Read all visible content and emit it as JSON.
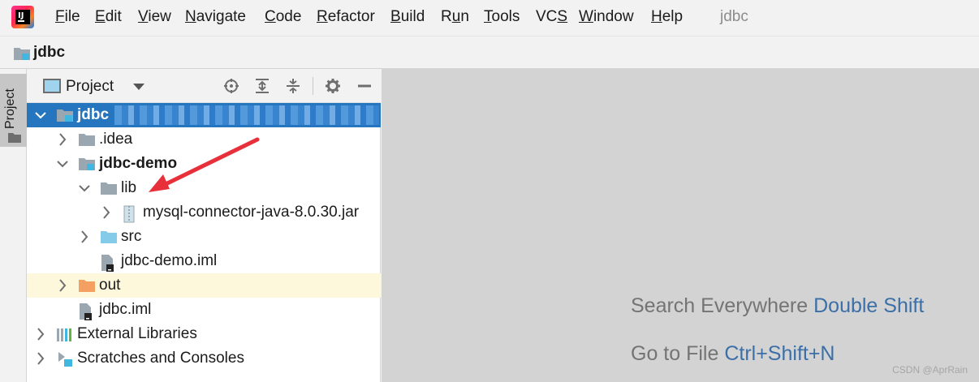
{
  "menu": {
    "items": [
      "File",
      "Edit",
      "View",
      "Navigate",
      "Code",
      "Refactor",
      "Build",
      "Run",
      "Tools",
      "VCS",
      "Window",
      "Help"
    ],
    "mnemonics": [
      "F",
      "E",
      "V",
      "N",
      "C",
      "R",
      "B",
      "u",
      "T",
      "S",
      "W",
      "H"
    ],
    "window_title": "jdbc"
  },
  "navbar": {
    "project_name": "jdbc"
  },
  "left_strip": {
    "project_tab": "Project"
  },
  "panel": {
    "title": "Project",
    "icons": [
      "locate-icon",
      "expand-all-icon",
      "collapse-all-icon",
      "gear-icon",
      "hide-icon"
    ]
  },
  "tree": [
    {
      "label": "jdbc",
      "indent": 0,
      "expanded": true,
      "icon": "module-folder-icon",
      "bold": true,
      "selected": true
    },
    {
      "label": ".idea",
      "indent": 1,
      "expanded": false,
      "icon": "folder-icon"
    },
    {
      "label": "jdbc-demo",
      "indent": 1,
      "expanded": true,
      "icon": "module-folder-icon",
      "bold": true
    },
    {
      "label": "lib",
      "indent": 2,
      "expanded": true,
      "icon": "folder-icon"
    },
    {
      "label": "mysql-connector-java-8.0.30.jar",
      "indent": 3,
      "expanded": false,
      "icon": "jar-icon"
    },
    {
      "label": "src",
      "indent": 2,
      "expanded": false,
      "icon": "source-folder-icon"
    },
    {
      "label": "jdbc-demo.iml",
      "indent": 2,
      "icon": "iml-file-icon"
    },
    {
      "label": "out",
      "indent": 1,
      "expanded": false,
      "icon": "excluded-folder-icon",
      "highlight": true
    },
    {
      "label": "jdbc.iml",
      "indent": 1,
      "icon": "iml-file-icon"
    },
    {
      "label": "External Libraries",
      "indent": 0,
      "expanded": false,
      "icon": "libraries-icon"
    },
    {
      "label": "Scratches and Consoles",
      "indent": 0,
      "expanded": false,
      "icon": "scratches-icon"
    }
  ],
  "editor": {
    "hints": [
      {
        "text": "Search Everywhere",
        "key": "Double Shift"
      },
      {
        "text": "Go to File",
        "key": "Ctrl+Shift+N"
      }
    ]
  },
  "watermark": "CSDN @AprRain",
  "colors": {
    "selection": "#2675bf",
    "highlight_row": "#fdf8dc",
    "arrow": "#e8303a",
    "key_text": "#3c6fa7"
  }
}
